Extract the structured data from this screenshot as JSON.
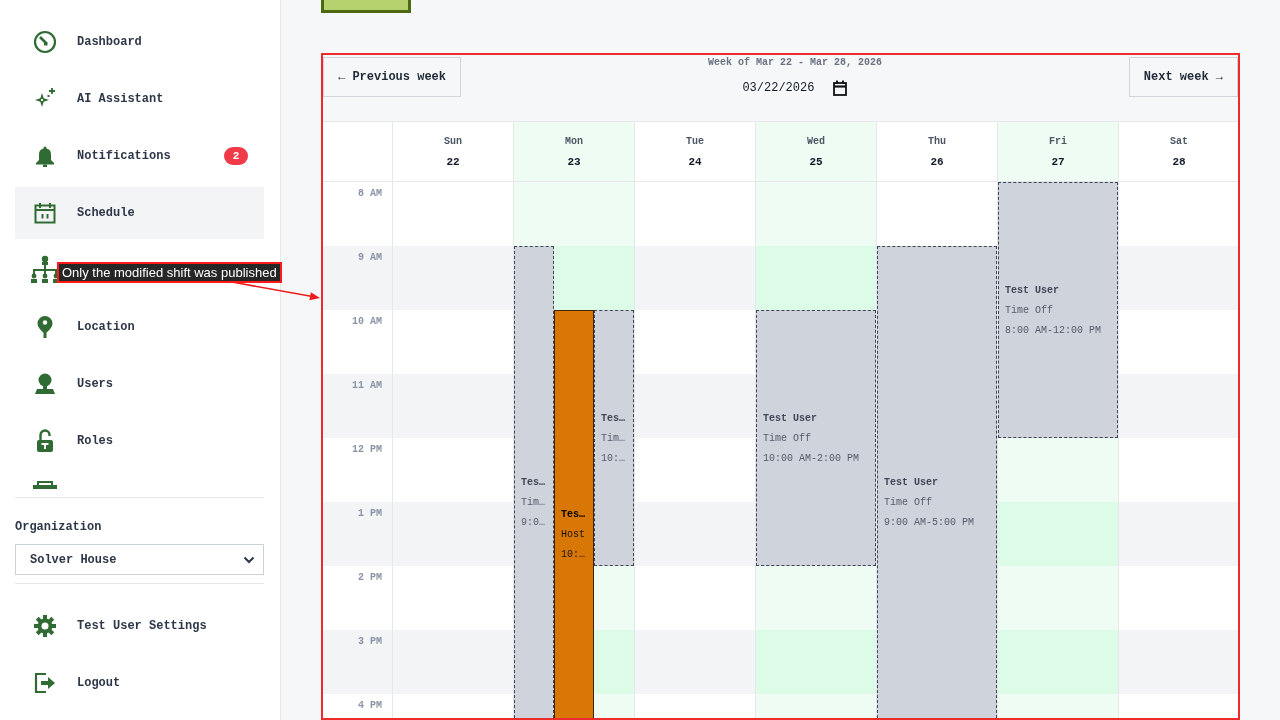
{
  "sidebar": {
    "nav_items": [
      {
        "label": "Dashboard",
        "selected": false
      },
      {
        "label": "AI Assistant",
        "selected": false
      },
      {
        "label": "Notifications",
        "selected": false,
        "badge": "2"
      },
      {
        "label": "Schedule",
        "selected": true
      },
      {
        "selected": false
      },
      {
        "label": "Location",
        "selected": false
      },
      {
        "label": "Users",
        "selected": false
      },
      {
        "label": "Roles",
        "selected": false
      }
    ],
    "organization": {
      "label": "Organization",
      "value": "Solver House"
    },
    "footer_items": [
      {
        "label": "Test User Settings"
      },
      {
        "label": "Logout"
      }
    ]
  },
  "tooltip": {
    "text": "Only the modified shift was published"
  },
  "calendar": {
    "highlighted": true,
    "previous_button": "← Previous week",
    "week_label": "Week of Mar 22 - Mar 28, 2026",
    "date_value": "03/22/2026",
    "next_button": "Next week →",
    "hours": [
      "8 AM",
      "9 AM",
      "10 AM",
      "11 AM",
      "12 PM",
      "1 PM",
      "2 PM",
      "3 PM",
      "4 PM"
    ],
    "days": [
      {
        "name": "Sun",
        "date": "22",
        "available": false
      },
      {
        "name": "Mon",
        "date": "23",
        "available": true,
        "events": [
          {
            "kind": "time_off",
            "title": "Tes…",
            "subtitle": "Tim…",
            "time": "9:0…"
          },
          {
            "kind": "shift",
            "title": "Tes…",
            "subtitle": "Host",
            "time": "10:…"
          },
          {
            "kind": "time_off",
            "title": "Tes…",
            "subtitle": "Tim…",
            "time": "10:…"
          }
        ]
      },
      {
        "name": "Tue",
        "date": "24",
        "available": false
      },
      {
        "name": "Wed",
        "date": "25",
        "available": true,
        "events": [
          {
            "kind": "time_off",
            "title": "Test User",
            "subtitle": "Time Off",
            "time": "10:00 AM-2:00 PM"
          }
        ]
      },
      {
        "name": "Thu",
        "date": "26",
        "available": false,
        "events": [
          {
            "kind": "time_off",
            "title": "Test User",
            "subtitle": "Time Off",
            "time": "9:00 AM-5:00 PM"
          }
        ]
      },
      {
        "name": "Fri",
        "date": "27",
        "available": true,
        "events": [
          {
            "kind": "time_off",
            "title": "Test User",
            "subtitle": "Time Off",
            "time": "8:00 AM-12:00 PM"
          }
        ]
      },
      {
        "name": "Sat",
        "date": "28",
        "available": false
      }
    ]
  }
}
